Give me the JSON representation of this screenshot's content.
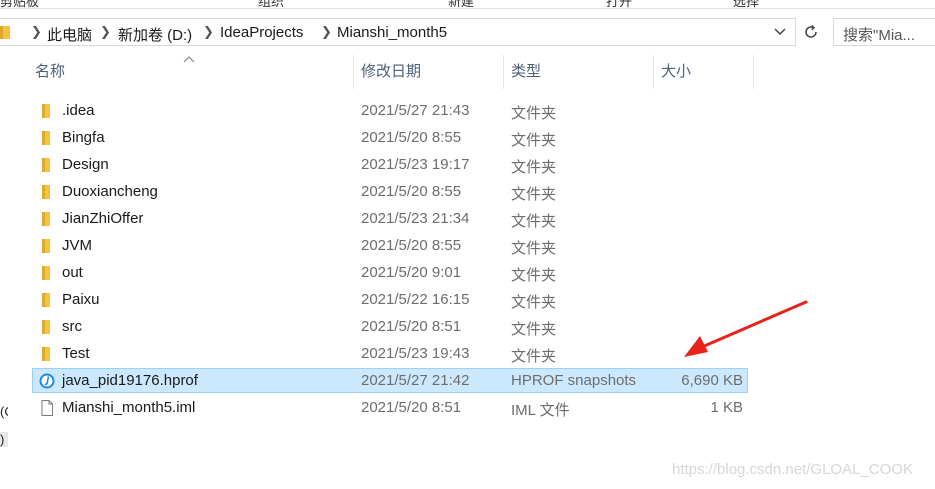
{
  "ribbon": {
    "tabs": [
      "剪贴板",
      "组织",
      "新建",
      "打开",
      "选择"
    ]
  },
  "address_bar": {
    "crumbs": [
      "此电脑",
      "新加卷 (D:)",
      "IdeaProjects",
      "Mianshi_month5"
    ]
  },
  "search": {
    "placeholder": "搜索\"Mia..."
  },
  "columns": {
    "name": "名称",
    "date": "修改日期",
    "type": "类型",
    "size": "大小"
  },
  "files": [
    {
      "name": ".idea",
      "date": "2021/5/27 21:43",
      "type": "文件夹",
      "size": "",
      "kind": "folder"
    },
    {
      "name": "Bingfa",
      "date": "2021/5/20 8:55",
      "type": "文件夹",
      "size": "",
      "kind": "folder"
    },
    {
      "name": "Design",
      "date": "2021/5/23 19:17",
      "type": "文件夹",
      "size": "",
      "kind": "folder"
    },
    {
      "name": "Duoxiancheng",
      "date": "2021/5/20 8:55",
      "type": "文件夹",
      "size": "",
      "kind": "folder"
    },
    {
      "name": "JianZhiOffer",
      "date": "2021/5/23 21:34",
      "type": "文件夹",
      "size": "",
      "kind": "folder"
    },
    {
      "name": "JVM",
      "date": "2021/5/20 8:55",
      "type": "文件夹",
      "size": "",
      "kind": "folder"
    },
    {
      "name": "out",
      "date": "2021/5/20 9:01",
      "type": "文件夹",
      "size": "",
      "kind": "folder"
    },
    {
      "name": "Paixu",
      "date": "2021/5/22 16:15",
      "type": "文件夹",
      "size": "",
      "kind": "folder"
    },
    {
      "name": "src",
      "date": "2021/5/20 8:51",
      "type": "文件夹",
      "size": "",
      "kind": "folder"
    },
    {
      "name": "Test",
      "date": "2021/5/23 19:43",
      "type": "文件夹",
      "size": "",
      "kind": "folder"
    },
    {
      "name": "java_pid19176.hprof",
      "date": "2021/5/27 21:42",
      "type": "HPROF snapshots",
      "size": "6,690 KB",
      "kind": "hprof",
      "selected": true
    },
    {
      "name": "Mianshi_month5.iml",
      "date": "2021/5/20 8:51",
      "type": "IML 文件",
      "size": "1 KB",
      "kind": "file"
    }
  ],
  "left_fragments": [
    "(C",
    ")"
  ],
  "watermark": "https://blog.csdn.net/GLOAL_COOK",
  "colors": {
    "folder": "#f5c342",
    "selection_bg": "#cce8ff",
    "selection_border": "#99d1ff",
    "annotation_arrow": "#e8231a",
    "hprof_icon": "#1e88e5"
  },
  "icons": {
    "folder": "folder-icon",
    "hprof": "hprof-snapshot-icon",
    "file": "document-icon",
    "refresh": "refresh-icon",
    "dropdown": "chevron-down-icon",
    "sort": "sort-up-arrow-icon",
    "separator": "chevron-right-icon"
  }
}
